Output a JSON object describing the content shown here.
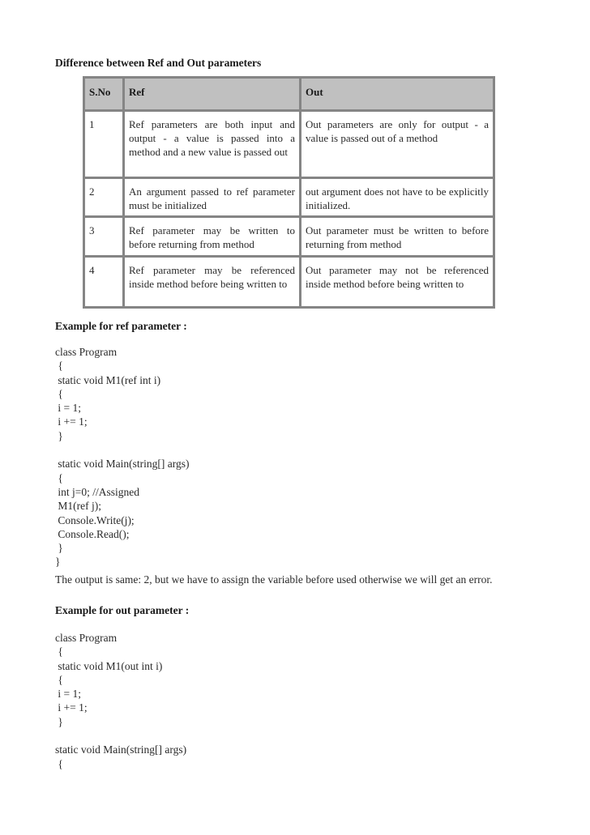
{
  "title": "Difference between Ref and Out parameters",
  "table": {
    "headers": [
      "S.No",
      "Ref",
      "Out"
    ],
    "rows": [
      {
        "sno": "1",
        "ref": "Ref parameters are both input and output - a value is passed into a method and a new value is passed out",
        "out": "Out parameters are only for output - a value is passed out of a method"
      },
      {
        "sno": "2",
        "ref": "An argument passed to ref parameter must be initialized",
        "out": "out argument does not have to be explicitly initialized."
      },
      {
        "sno": "3",
        "ref": "Ref parameter may be written to before returning from method",
        "out": "Out parameter must be written to before returning from method"
      },
      {
        "sno": "4",
        "ref": "Ref parameter may be referenced inside method before being written to",
        "out": "Out parameter may not be referenced inside method before being written to"
      }
    ]
  },
  "ref_example": {
    "heading": "Example for ref parameter :",
    "code": "class Program\n {\n static void M1(ref int i)\n {\n i = 1;\n i += 1;\n }\n\n static void Main(string[] args)\n {\n int j=0; //Assigned\n M1(ref j);\n Console.Write(j);\n Console.Read();\n }\n}"
  },
  "output_note": "The output is same: 2, but we have to assign the variable before used otherwise we will get an error.",
  "out_example": {
    "heading": "Example for out parameter :",
    "code": "class Program\n {\n static void M1(out int i)\n {\n i = 1;\n i += 1;\n }\n\nstatic void Main(string[] args)\n {"
  }
}
